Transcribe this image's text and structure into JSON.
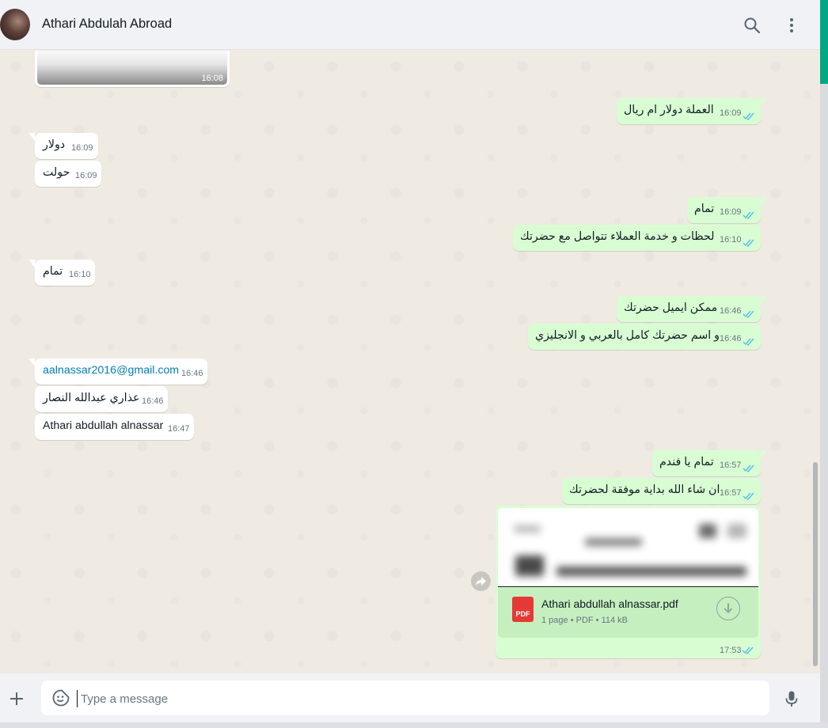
{
  "header": {
    "contact_name": "Athari Abdulah Abroad",
    "icons": [
      "search-icon",
      "kebab-menu-icon"
    ]
  },
  "colors": {
    "outgoing_bubble": "#d9fdd3",
    "incoming_bubble": "#ffffff",
    "read_ticks": "#53bdeb",
    "accent": "#00a884",
    "pdf_icon": "#e53935"
  },
  "image_message": {
    "time": "16:08"
  },
  "messages": [
    {
      "text": "العملة دولار ام ريال",
      "time": "16:09",
      "dir": "out",
      "status": "read"
    },
    {
      "text": "دولار",
      "time": "16:09",
      "dir": "in"
    },
    {
      "text": "حولت",
      "time": "16:09",
      "dir": "in"
    },
    {
      "text": "تمام",
      "time": "16:09",
      "dir": "out",
      "status": "read"
    },
    {
      "text": "لحظات و خدمة العملاء تتواصل مع حضرتك",
      "time": "16:10",
      "dir": "out",
      "status": "read"
    },
    {
      "text": "تمام",
      "time": "16:10",
      "dir": "in"
    },
    {
      "text": "ممكن ايميل حضرتك",
      "time": "16:46",
      "dir": "out",
      "status": "read"
    },
    {
      "text": "و اسم حضرتك كامل بالعربي و الانجليزي",
      "time": "16:46",
      "dir": "out",
      "status": "read"
    },
    {
      "text": "aalnassar2016@gmail.com",
      "time": "16:46",
      "dir": "in",
      "link": true
    },
    {
      "text": "عذاري عبدالله النصار",
      "time": "16:46",
      "dir": "in"
    },
    {
      "text": "Athari abdullah alnassar",
      "time": "16:47",
      "dir": "in"
    },
    {
      "text": "تمام يا فندم",
      "time": "16:57",
      "dir": "out",
      "status": "read"
    },
    {
      "text": "ان شاء الله بداية موفقة لحضرتك",
      "time": "16:57",
      "dir": "out",
      "status": "read"
    }
  ],
  "document": {
    "file_name": "Athari abdullah alnassar.pdf",
    "meta": "1 page • PDF • 114 kB",
    "icon_label": "PDF",
    "time": "17:53",
    "status": "read"
  },
  "composer": {
    "placeholder": "Type a message",
    "icons": [
      "plus-icon",
      "sticker-icon",
      "mic-icon"
    ]
  }
}
